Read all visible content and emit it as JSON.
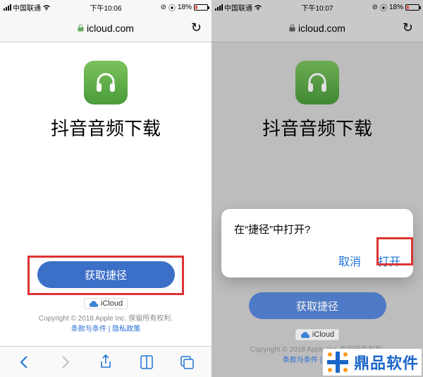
{
  "status": {
    "carrier": "中国联通",
    "wifi": "wifi",
    "time_left": "下午10:06",
    "time_right": "下午10:07",
    "alarm": "⦿",
    "orientation": "⊘",
    "battery_pct": "18%"
  },
  "url": {
    "host": "icloud.com"
  },
  "app": {
    "title": "抖音音频下载"
  },
  "cta": {
    "label": "获取捷径"
  },
  "icloud_badge": "iCloud",
  "footer": {
    "copyright": "Copyright © 2018 Apple Inc. 保留所有权利.",
    "terms": "条款与条件",
    "sep": " | ",
    "privacy": "隐私政策"
  },
  "alert": {
    "message": "在“捷径”中打开?",
    "cancel": "取消",
    "open": "打开"
  },
  "watermark": "鼎品软件"
}
